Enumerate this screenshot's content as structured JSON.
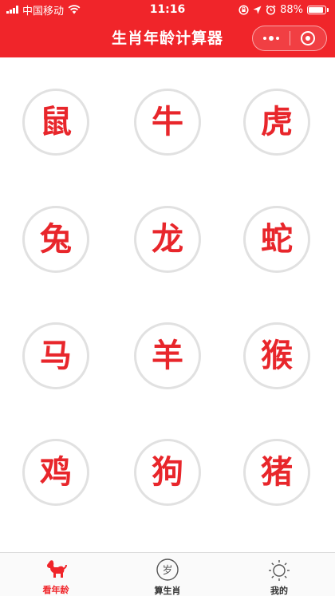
{
  "status_bar": {
    "carrier": "中国移动",
    "time": "11:16",
    "battery": "88%"
  },
  "nav": {
    "title": "生肖年龄计算器"
  },
  "zodiac": [
    {
      "char": "鼠"
    },
    {
      "char": "牛"
    },
    {
      "char": "虎"
    },
    {
      "char": "兔"
    },
    {
      "char": "龙"
    },
    {
      "char": "蛇"
    },
    {
      "char": "马"
    },
    {
      "char": "羊"
    },
    {
      "char": "猴"
    },
    {
      "char": "鸡"
    },
    {
      "char": "狗"
    },
    {
      "char": "猪"
    }
  ],
  "tabbar": {
    "tabs": [
      {
        "label": "看年龄",
        "icon": "dog-icon",
        "active": true
      },
      {
        "label": "算生肖",
        "icon": "sui-badge-icon",
        "active": false
      },
      {
        "label": "我的",
        "icon": "sun-icon",
        "active": false
      }
    ],
    "badge_char": "岁"
  },
  "colors": {
    "brand_red": "#f0252a",
    "zodiac_red": "#e8262b",
    "circle_border": "#e1e1e1"
  }
}
